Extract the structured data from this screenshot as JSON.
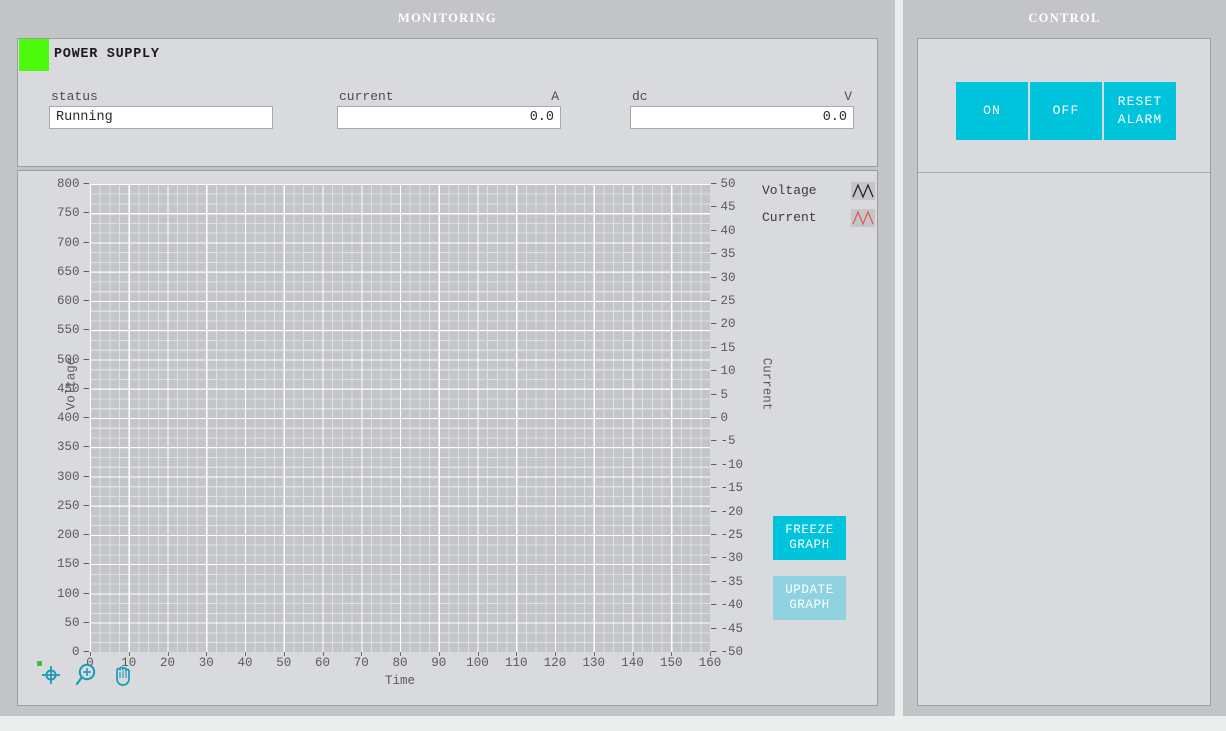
{
  "monitoring": {
    "title": "MONITORING",
    "device": {
      "name": "POWER SUPPLY",
      "led_color": "#4dfa0d",
      "fields": [
        {
          "label": "status",
          "unit": "",
          "value": "Running",
          "align": "left"
        },
        {
          "label": "current",
          "unit": "A",
          "value": "0.0",
          "align": "right"
        },
        {
          "label": "dc",
          "unit": "V",
          "value": "0.0",
          "align": "right"
        }
      ]
    },
    "graph": {
      "legend": [
        {
          "name": "Voltage",
          "color": "#1b1b1b"
        },
        {
          "name": "Current",
          "color": "#e8524a"
        }
      ],
      "buttons": [
        {
          "id": "freeze",
          "line1": "FREEZE",
          "line2": "GRAPH",
          "color": "#00c3dc",
          "state": "enabled"
        },
        {
          "id": "update",
          "line1": "UPDATE",
          "line2": "GRAPH",
          "color": "#8fd2df",
          "state": "disabled"
        }
      ],
      "tools": [
        {
          "name": "cursor-crosshair-icon"
        },
        {
          "name": "zoom-in-icon"
        },
        {
          "name": "pan-hand-icon"
        }
      ]
    }
  },
  "control": {
    "title": "CONTROL",
    "buttons": [
      {
        "id": "on",
        "line1": "ON",
        "line2": "",
        "color": "#00c3dc"
      },
      {
        "id": "off",
        "line1": "OFF",
        "line2": "",
        "color": "#00c3dc"
      },
      {
        "id": "reset-alarm",
        "line1": "RESET",
        "line2": "ALARM",
        "color": "#00c3dc"
      }
    ]
  },
  "chart_data": {
    "type": "line",
    "title": "",
    "xlabel": "Time",
    "ylabel": "Voltage",
    "y2label": "Current",
    "xlim": [
      0,
      160
    ],
    "xticks": [
      0,
      10,
      20,
      30,
      40,
      50,
      60,
      70,
      80,
      90,
      100,
      110,
      120,
      130,
      140,
      150,
      160
    ],
    "ylim": [
      0,
      800
    ],
    "yticks": [
      0,
      50,
      100,
      150,
      200,
      250,
      300,
      350,
      400,
      450,
      500,
      550,
      600,
      650,
      700,
      750,
      800
    ],
    "y2lim": [
      -50,
      50
    ],
    "y2ticks": [
      -50,
      -45,
      -40,
      -35,
      -30,
      -25,
      -20,
      -15,
      -10,
      -5,
      0,
      5,
      10,
      15,
      20,
      25,
      30,
      35,
      40,
      45,
      50
    ],
    "grid": true,
    "legend_position": "top-right",
    "series": [
      {
        "name": "Voltage",
        "axis": "left",
        "color": "#1b1b1b",
        "x": [],
        "values": []
      },
      {
        "name": "Current",
        "axis": "right",
        "color": "#e8524a",
        "x": [],
        "values": []
      }
    ],
    "plot_background": "#c3c5ca",
    "gridline_color": "#ffffff"
  }
}
